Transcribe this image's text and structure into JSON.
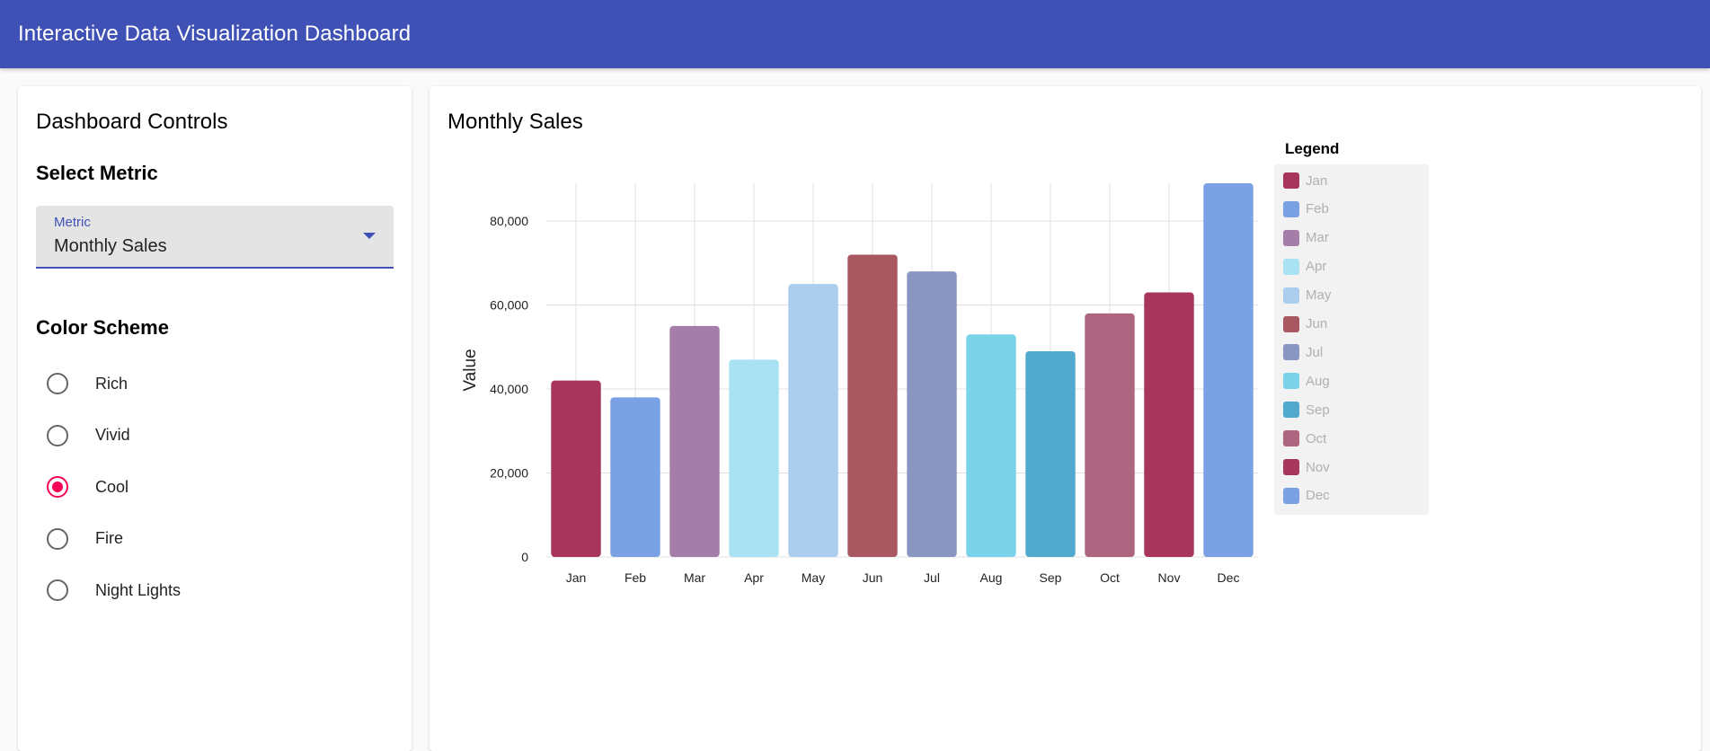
{
  "app": {
    "title": "Interactive Data Visualization Dashboard"
  },
  "controls": {
    "title": "Dashboard Controls",
    "metric_heading": "Select Metric",
    "metric_label": "Metric",
    "metric_value": "Monthly Sales",
    "color_heading": "Color Scheme",
    "color_options": [
      {
        "label": "Rich",
        "checked": false
      },
      {
        "label": "Vivid",
        "checked": false
      },
      {
        "label": "Cool",
        "checked": true
      },
      {
        "label": "Fire",
        "checked": false
      },
      {
        "label": "Night Lights",
        "checked": false
      }
    ],
    "accent_color": "#3f51b5",
    "radio_checked_color": "#f50057"
  },
  "chart_panel": {
    "title": "Monthly Sales",
    "legend_title": "Legend"
  },
  "chart_data": {
    "type": "bar",
    "categories": [
      "Jan",
      "Feb",
      "Mar",
      "Apr",
      "May",
      "Jun",
      "Jul",
      "Aug",
      "Sep",
      "Oct",
      "Nov",
      "Dec"
    ],
    "values": [
      42000,
      38000,
      55000,
      47000,
      65000,
      72000,
      68000,
      53000,
      49000,
      58000,
      63000,
      89000
    ],
    "colors": [
      "#a8365c",
      "#7aa1e4",
      "#a47ea9",
      "#a9e2f3",
      "#abcdee",
      "#a95862",
      "#8996c2",
      "#7bd3ea",
      "#51a9ce",
      "#ad6580",
      "#a8365c",
      "#7aa1e4"
    ],
    "xlabel": "Monthly Sales",
    "ylabel": "Value",
    "ylim": [
      0,
      89000
    ],
    "yticks": [
      0,
      20000,
      40000,
      60000,
      80000
    ],
    "ytick_labels": [
      "0",
      "20,000",
      "40,000",
      "60,000",
      "80,000"
    ],
    "grid": true,
    "legend_position": "right"
  }
}
